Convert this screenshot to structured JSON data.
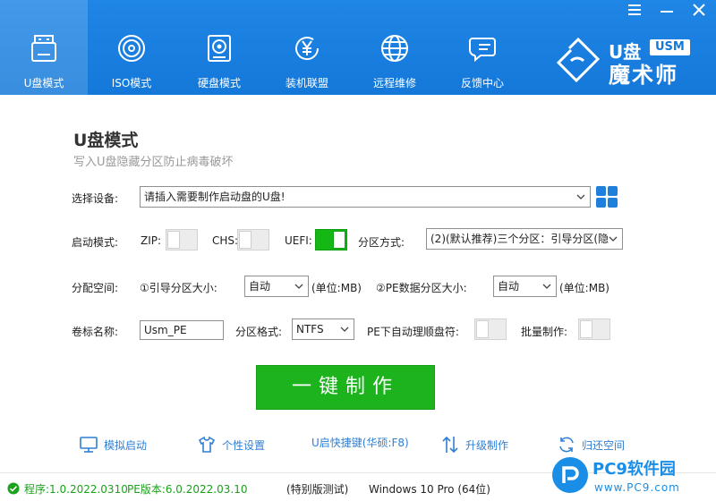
{
  "window_controls": [
    "minimize",
    "restore",
    "close"
  ],
  "nav": [
    {
      "label": "U盘模式",
      "icon": "usb-drive-icon",
      "active": true
    },
    {
      "label": "ISO模式",
      "icon": "disc-icon",
      "active": false
    },
    {
      "label": "硬盘模式",
      "icon": "hard-disk-icon",
      "active": false
    },
    {
      "label": "装机联盟",
      "icon": "yen-coin-icon",
      "active": false
    },
    {
      "label": "远程维修",
      "icon": "globe-icon",
      "active": false
    },
    {
      "label": "反馈中心",
      "icon": "chat-icon",
      "active": false
    }
  ],
  "brand": {
    "line1": "U盘",
    "badge": "USM",
    "line2": "魔术师"
  },
  "page": {
    "title": "U盘模式",
    "subtitle": "写入U盘隐藏分区防止病毒破坏"
  },
  "device": {
    "label": "选择设备:",
    "value": "请插入需要制作启动盘的U盘!"
  },
  "boot_mode": {
    "label": "启动模式:",
    "zip_label": "ZIP:",
    "zip_on": false,
    "chs_label": "CHS:",
    "chs_on": false,
    "uefi_label": "UEFI:",
    "uefi_on": true,
    "partition_label": "分区方式:",
    "partition_value": "(2)(默认推荐)三个分区：引导分区(隐"
  },
  "alloc": {
    "label": "分配空间:",
    "boot_size_label": "①引导分区大小:",
    "boot_size_value": "自动",
    "boot_unit": "(单位:MB)",
    "pe_size_label": "②PE数据分区大小:",
    "pe_size_value": "自动",
    "pe_unit": "(单位:MB)"
  },
  "volume": {
    "label": "卷标名称:",
    "value": "Usm_PE",
    "format_label": "分区格式:",
    "format_value": "NTFS",
    "auto_label": "PE下自动理顺盘符:",
    "auto_on": false,
    "batch_label": "批量制作:",
    "batch_on": false
  },
  "main_button": "一键制作",
  "tools": [
    {
      "label": "模拟启动",
      "icon": "monitor-icon"
    },
    {
      "label": "个性设置",
      "icon": "tshirt-icon"
    },
    {
      "label": "U启快捷键(华硕:F8)",
      "icon": ""
    },
    {
      "label": "升级制作",
      "icon": "updown-arrows-icon"
    },
    {
      "label": "归还空间",
      "icon": "refresh-icon"
    }
  ],
  "status": {
    "program": "程序:1.0.2022.0310",
    "pe_version": "PE版本:6.0.2022.03.10",
    "edition": "(特别版测试)",
    "os": "Windows 10 Pro (64位)"
  },
  "watermark": {
    "name": "PC9软件园",
    "url": "www.PC9.com"
  },
  "colors": {
    "header": "#1478d9",
    "green": "#1db31d",
    "link": "#2f7fd4"
  }
}
